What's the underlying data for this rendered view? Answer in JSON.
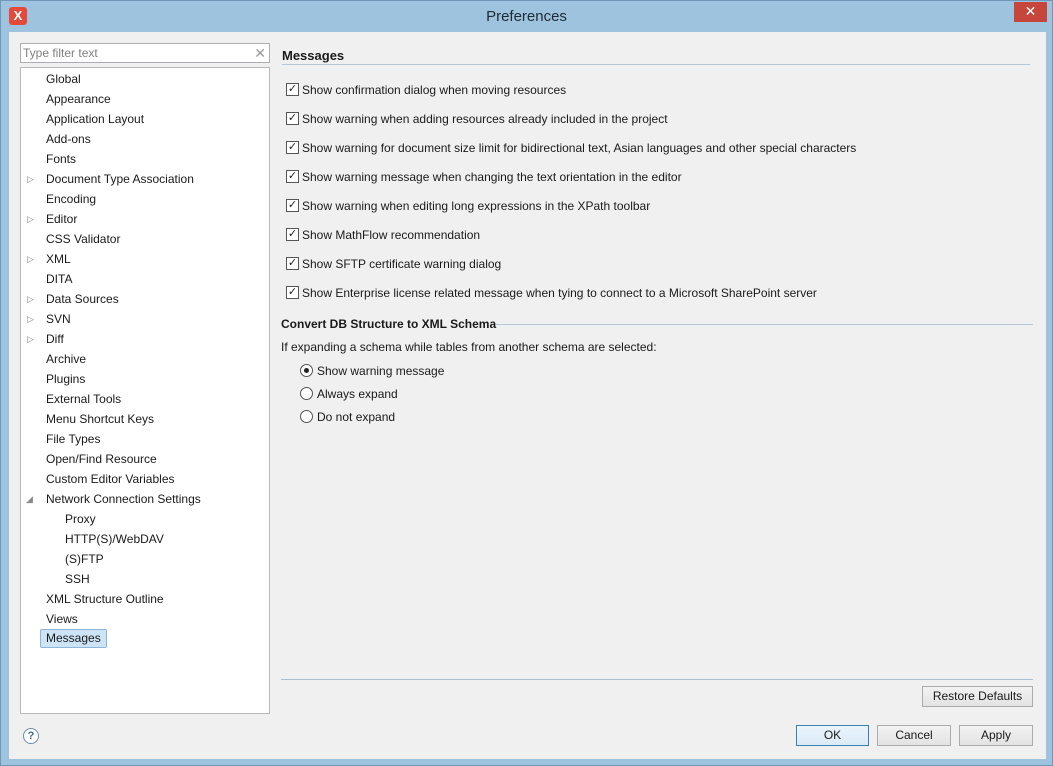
{
  "window": {
    "title": "Preferences",
    "app_icon_glyph": "X",
    "close_glyph": "✕"
  },
  "sidebar": {
    "filter_placeholder": "Type filter text",
    "filter_clear_glyph": "✕",
    "items": [
      {
        "label": "Global",
        "expander": ""
      },
      {
        "label": "Appearance",
        "expander": ""
      },
      {
        "label": "Application Layout",
        "expander": ""
      },
      {
        "label": "Add-ons",
        "expander": ""
      },
      {
        "label": "Fonts",
        "expander": ""
      },
      {
        "label": "Document Type Association",
        "expander": "▷"
      },
      {
        "label": "Encoding",
        "expander": ""
      },
      {
        "label": "Editor",
        "expander": "▷"
      },
      {
        "label": "CSS Validator",
        "expander": ""
      },
      {
        "label": "XML",
        "expander": "▷"
      },
      {
        "label": "DITA",
        "expander": ""
      },
      {
        "label": "Data Sources",
        "expander": "▷"
      },
      {
        "label": "SVN",
        "expander": "▷"
      },
      {
        "label": "Diff",
        "expander": "▷"
      },
      {
        "label": "Archive",
        "expander": ""
      },
      {
        "label": "Plugins",
        "expander": ""
      },
      {
        "label": "External Tools",
        "expander": ""
      },
      {
        "label": "Menu Shortcut Keys",
        "expander": ""
      },
      {
        "label": "File Types",
        "expander": ""
      },
      {
        "label": "Open/Find Resource",
        "expander": ""
      },
      {
        "label": "Custom Editor Variables",
        "expander": ""
      },
      {
        "label": "Network Connection Settings",
        "expander": "◢"
      },
      {
        "label": "Proxy",
        "expander": ""
      },
      {
        "label": "HTTP(S)/WebDAV",
        "expander": ""
      },
      {
        "label": "(S)FTP",
        "expander": ""
      },
      {
        "label": "SSH",
        "expander": ""
      },
      {
        "label": "XML Structure Outline",
        "expander": ""
      },
      {
        "label": "Views",
        "expander": ""
      },
      {
        "label": "Messages",
        "expander": ""
      }
    ]
  },
  "main": {
    "section_title": "Messages",
    "checkboxes": [
      {
        "label": "Show confirmation dialog when moving resources",
        "checked": true
      },
      {
        "label": "Show warning when adding resources already included in the project",
        "checked": true
      },
      {
        "label": "Show warning for document size limit for bidirectional text, Asian languages and other special characters",
        "checked": true
      },
      {
        "label": "Show warning message when changing the text orientation in the editor",
        "checked": true
      },
      {
        "label": "Show warning when editing long expressions in the XPath toolbar",
        "checked": true
      },
      {
        "label": "Show MathFlow recommendation",
        "checked": true
      },
      {
        "label": "Show SFTP certificate warning dialog",
        "checked": true
      },
      {
        "label": "Show Enterprise license related message when tying to connect to a Microsoft SharePoint server",
        "checked": true
      }
    ],
    "check_glyph": "✓",
    "db_section_title": "Convert DB Structure to XML Schema",
    "db_prompt": "If expanding a schema while tables from another schema are selected:",
    "radios": [
      {
        "label": "Show warning message",
        "selected": true
      },
      {
        "label": "Always expand",
        "selected": false
      },
      {
        "label": "Do not expand",
        "selected": false
      }
    ]
  },
  "buttons": {
    "restore_defaults": "Restore Defaults",
    "ok": "OK",
    "cancel": "Cancel",
    "apply": "Apply",
    "help_glyph": "?"
  }
}
